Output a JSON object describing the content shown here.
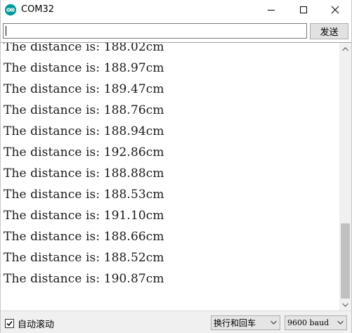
{
  "window": {
    "title": "COM32",
    "icon": "arduino-logo-icon",
    "controls": [
      "minimize-icon",
      "maximize-icon",
      "close-icon"
    ]
  },
  "send_row": {
    "input_value": "",
    "send_label": "发送"
  },
  "output": {
    "lines": [
      "The distance is: 188.02cm",
      "The distance is: 188.97cm",
      "The distance is: 189.47cm",
      "The distance is: 188.76cm",
      "The distance is: 188.94cm",
      "The distance is: 192.86cm",
      "The distance is: 188.88cm",
      "The distance is: 188.53cm",
      "The distance is: 191.10cm",
      "The distance is: 188.66cm",
      "The distance is: 188.52cm",
      "The distance is: 190.87cm"
    ],
    "scroll_position": 1.0
  },
  "bottom_bar": {
    "autoscroll_label": "自动滚动",
    "autoscroll_checked": true,
    "line_ending": "换行和回车",
    "baud_rate": "9600 baud"
  },
  "colors": {
    "accent": "#00979c",
    "scrollbar_thumb": "#c1c1c1",
    "text": "#1a1a1a"
  }
}
